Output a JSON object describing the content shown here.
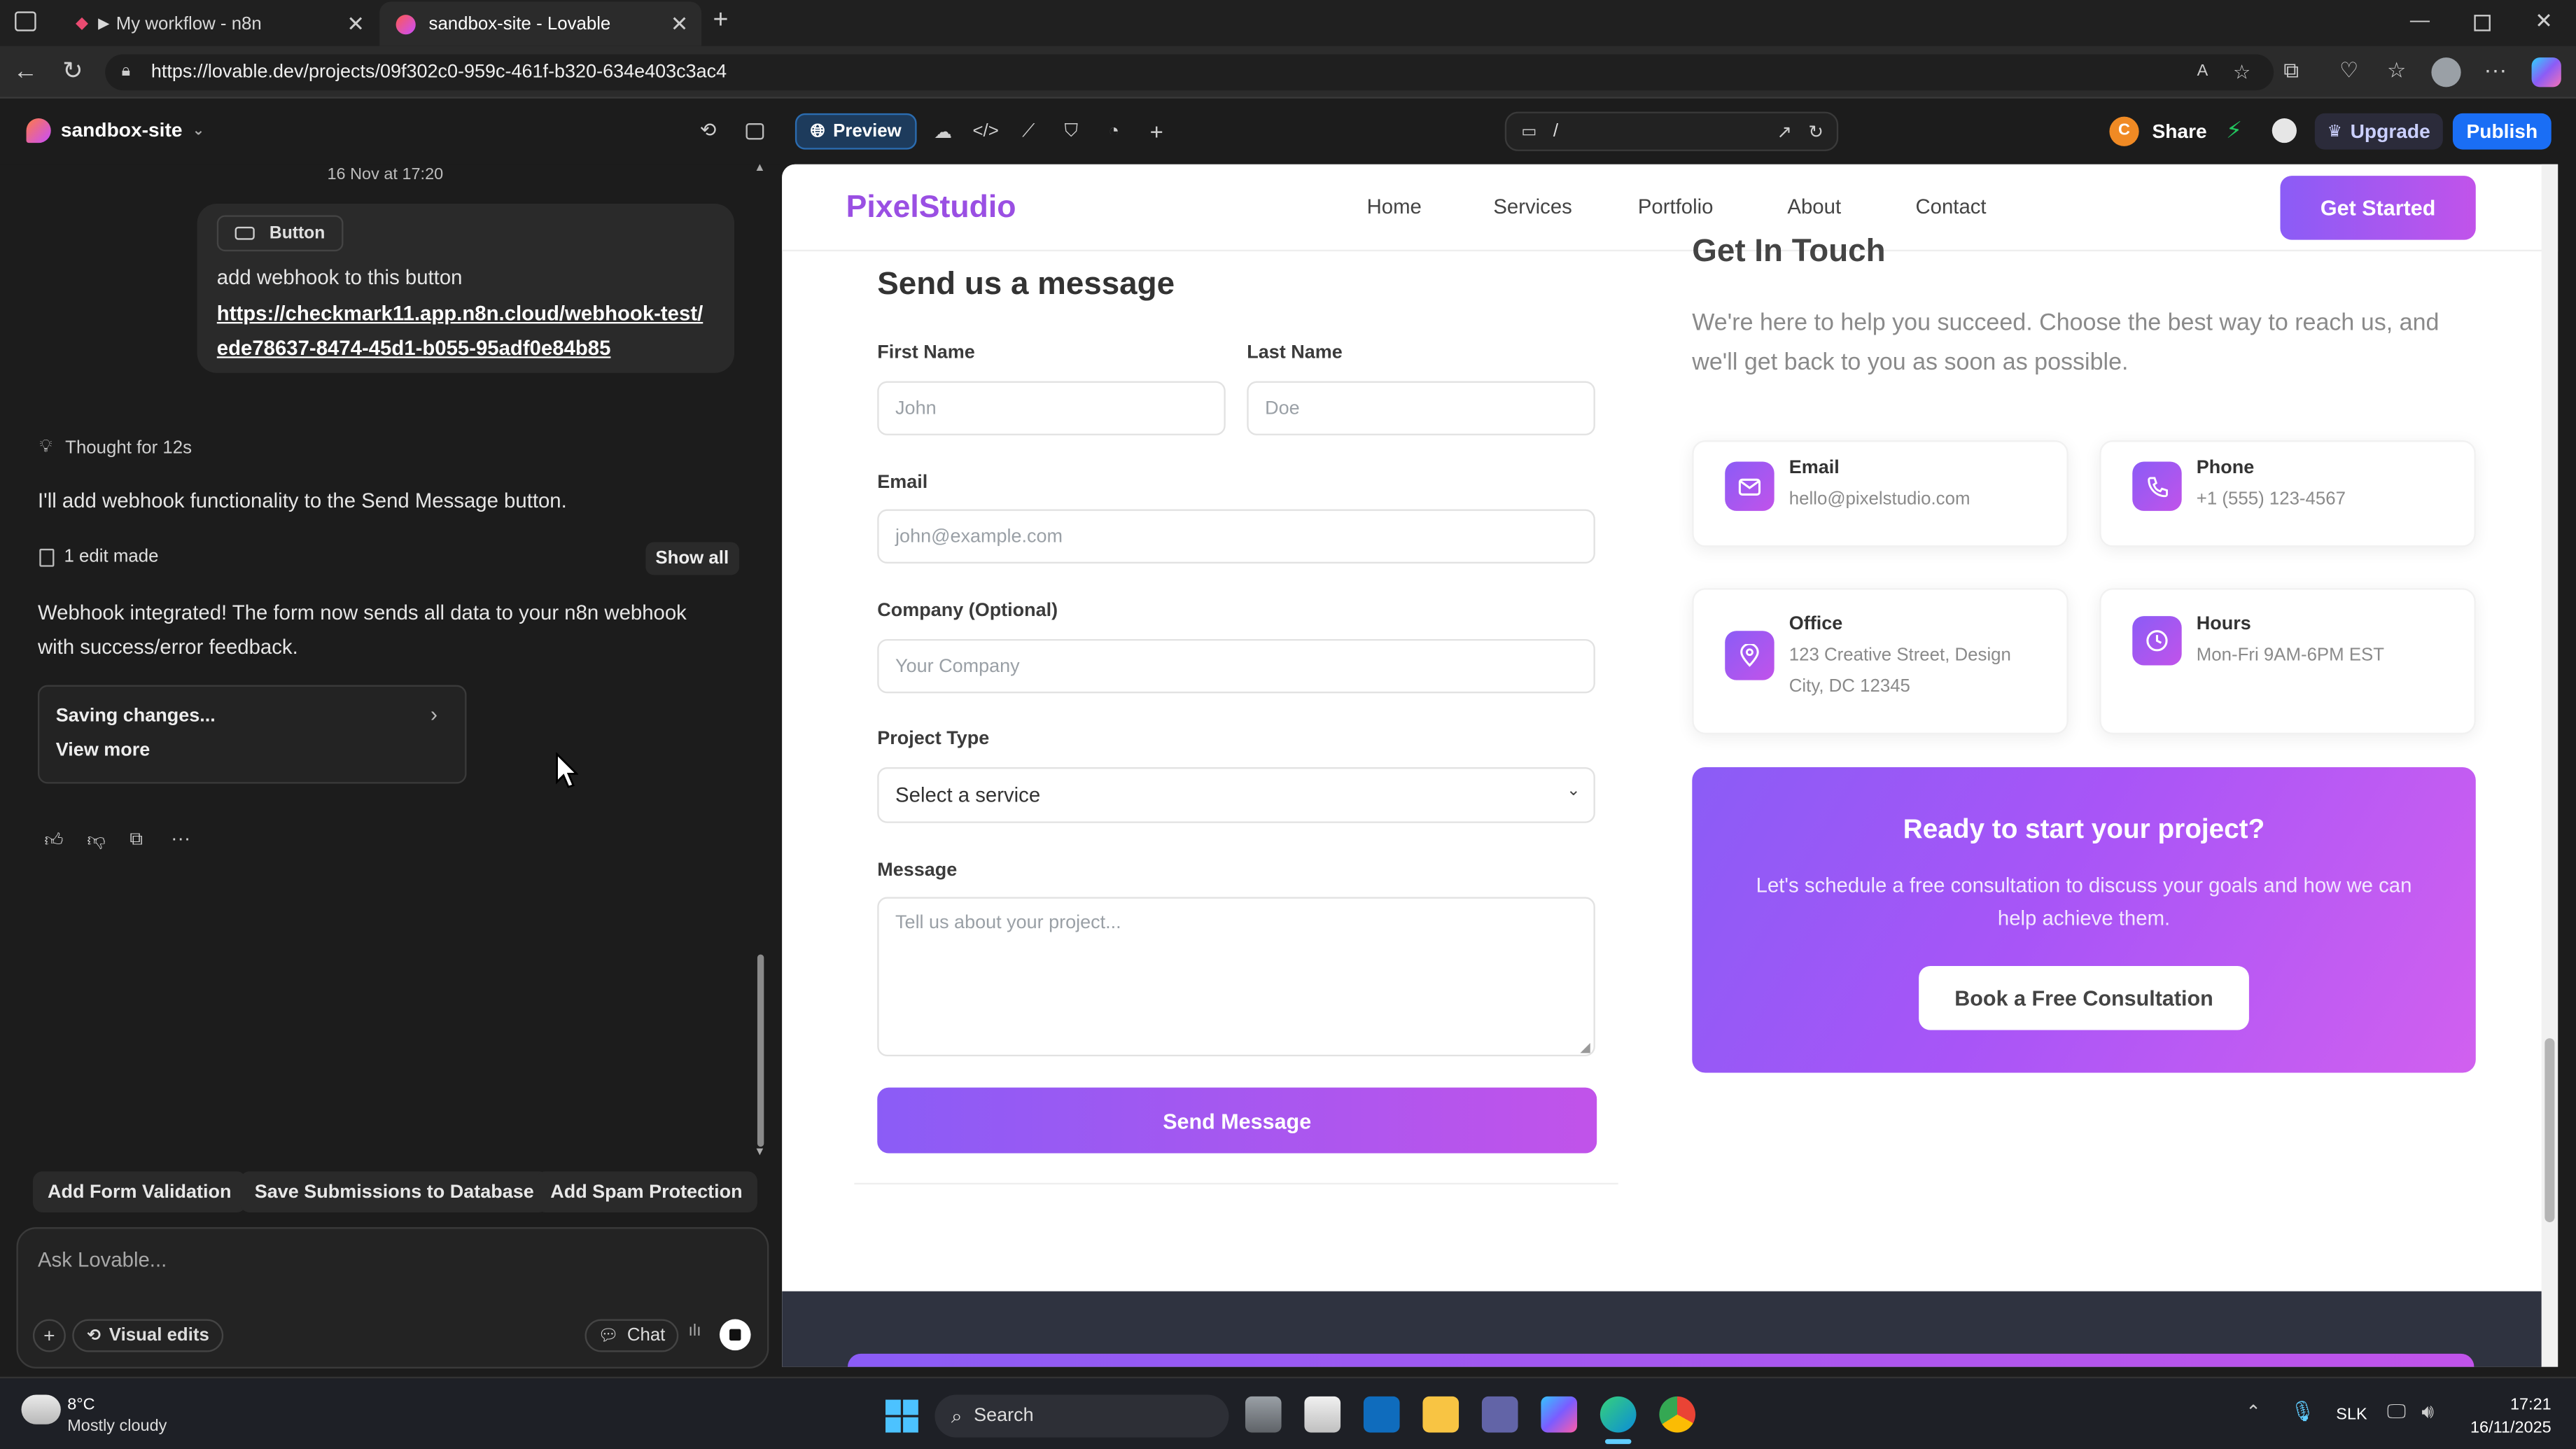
{
  "browser": {
    "tabs": [
      {
        "title": "My workflow - n8n"
      },
      {
        "title": "sandbox-site - Lovable"
      }
    ],
    "url": "https://lovable.dev/projects/09f302c0-959c-461f-b320-634e403c3ac4"
  },
  "app": {
    "project_name": "sandbox-site",
    "preview_label": "Preview",
    "route": "/",
    "share_label": "Share",
    "avatar_letter": "C",
    "upgrade_label": "Upgrade",
    "publish_label": "Publish"
  },
  "chat": {
    "timestamp": "16 Nov at 17:20",
    "user_message": {
      "tag": "Button",
      "text": "add webhook to this button",
      "link": "https://checkmark11.app.n8n.cloud/webhook-test/ede78637-8474-45d1-b055-95adf0e84b85"
    },
    "thought": "Thought for 12s",
    "reply_1": "I'll add webhook functionality to the Send Message button.",
    "edits": "1 edit made",
    "show_all": "Show all",
    "reply_2": "Webhook integrated! The form now sends all data to your n8n webhook with success/error feedback.",
    "status_title": "Saving changes...",
    "status_more": "View more",
    "suggestions": [
      "Add Form Validation",
      "Save Submissions to Database",
      "Add Spam Protection"
    ],
    "input_placeholder": "Ask Lovable...",
    "visual_edits": "Visual edits",
    "chat_mode": "Chat"
  },
  "site": {
    "logo": "PixelStudio",
    "nav": [
      "Home",
      "Services",
      "Portfolio",
      "About",
      "Contact"
    ],
    "cta": "Get Started",
    "form": {
      "heading": "Send us a message",
      "first_name_label": "First Name",
      "first_name_placeholder": "John",
      "last_name_label": "Last Name",
      "last_name_placeholder": "Doe",
      "email_label": "Email",
      "email_placeholder": "john@example.com",
      "company_label": "Company (Optional)",
      "company_placeholder": "Your Company",
      "project_label": "Project Type",
      "project_selected": "Select a service",
      "message_label": "Message",
      "message_placeholder": "Tell us about your project...",
      "submit": "Send Message"
    },
    "contact": {
      "heading": "Get In Touch",
      "intro": "We're here to help you succeed. Choose the best way to reach us, and we'll get back to you as soon as possible.",
      "cards": [
        {
          "title": "Email",
          "value": "hello@pixelstudio.com",
          "icon": "mail-icon"
        },
        {
          "title": "Phone",
          "value": "+1 (555) 123-4567",
          "icon": "phone-icon"
        },
        {
          "title": "Office",
          "value": "123 Creative Street, Design City, DC 12345",
          "icon": "map-pin-icon"
        },
        {
          "title": "Hours",
          "value": "Mon-Fri 9AM-6PM EST",
          "icon": "clock-icon"
        }
      ]
    },
    "promo": {
      "title": "Ready to start your project?",
      "text": "Let's schedule a free consultation to discuss your goals and how we can help achieve them.",
      "button": "Book a Free Consultation"
    }
  },
  "taskbar": {
    "weather_temp": "8°C",
    "weather_desc": "Mostly cloudy",
    "search": "Search",
    "lang": "SLK",
    "time": "17:21",
    "date": "16/11/2025"
  },
  "colors": {
    "brand_purple": "#8b5cf6",
    "brand_magenta": "#c153ea",
    "publish_blue": "#1a6ef5"
  }
}
